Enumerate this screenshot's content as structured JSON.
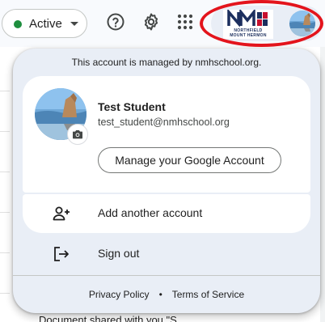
{
  "topbar": {
    "status_label": "Active",
    "icons": [
      "help-icon",
      "gear-icon",
      "apps-icon",
      "chevron-down-icon"
    ],
    "brand_logo": {
      "line1": "NORTHFIELD",
      "line2": "MOUNT HERMON"
    }
  },
  "popup": {
    "managed_text": "This account is managed by nmhschool.org.",
    "user": {
      "name": "Test Student",
      "email": "test_student@nmhschool.org"
    },
    "manage_button": "Manage your Google Account",
    "add_account_label": "Add another account",
    "sign_out_label": "Sign out",
    "footer": {
      "privacy": "Privacy Policy",
      "separator": "•",
      "terms": "Terms of Service"
    }
  },
  "background": {
    "footer_text": "Document shared with you \"S"
  },
  "colors": {
    "accent_red": "#e3141c",
    "status_green": "#1e8e3e",
    "popup_bg": "#e9eef6",
    "brand_navy": "#1c2f5e"
  }
}
